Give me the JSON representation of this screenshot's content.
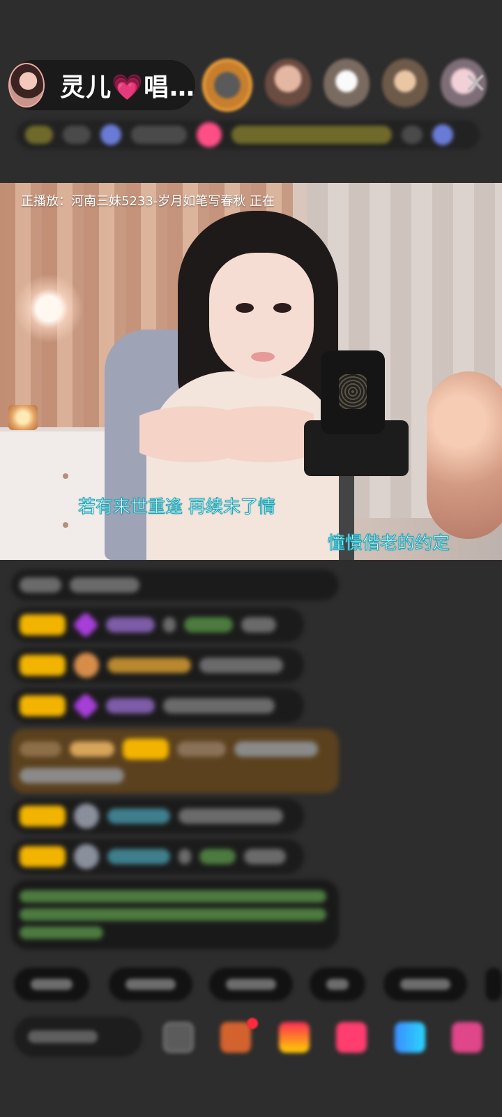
{
  "header": {
    "host_name": "灵儿",
    "host_name_suffix": "唱…",
    "heart": "💗",
    "close": "✕"
  },
  "video": {
    "now_playing": "正播放：河南三妹5233-岁月如笔写春秋  正在",
    "lyric_line_1": "若有来世重逢  再续未了情",
    "lyric_line_2": "憧憬偕老的约定"
  },
  "icons": [
    "close-icon",
    "gift-icon",
    "heart-icon",
    "game-icon",
    "more-icon",
    "diamond-icon"
  ],
  "colors": {
    "background": "#2d2d2d",
    "level_badge": "#f2b400",
    "lyric_stroke": "#1aa6b8",
    "notification_dot": "#ff2a3c"
  }
}
